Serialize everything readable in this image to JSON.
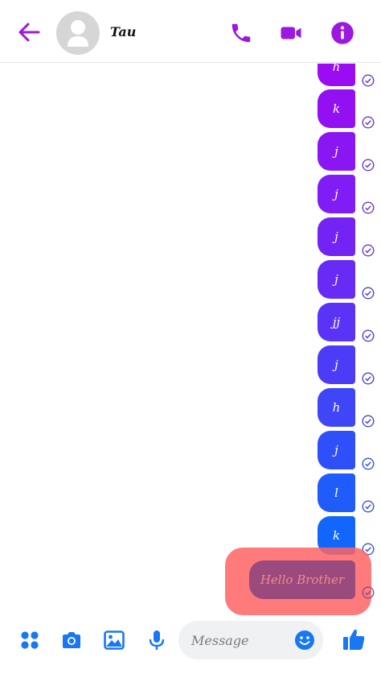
{
  "header": {
    "contact_name": "Tau",
    "icons": [
      "back-arrow-icon",
      "avatar-placeholder-icon",
      "phone-icon",
      "video-call-icon",
      "info-icon"
    ]
  },
  "colors": {
    "accent_purple": "#9b18e0",
    "accent_blue": "#1877f2"
  },
  "messages": [
    {
      "text": "h",
      "color": "#9a0df2"
    },
    {
      "text": "k",
      "color": "#9310f2"
    },
    {
      "text": "j",
      "color": "#8a16f3"
    },
    {
      "text": "j",
      "color": "#7f1df4"
    },
    {
      "text": "j",
      "color": "#7324f4"
    },
    {
      "text": "j",
      "color": "#672bf5"
    },
    {
      "text": "jj",
      "color": "#5a33f6"
    },
    {
      "text": "j",
      "color": "#4c3cf7"
    },
    {
      "text": "h",
      "color": "#3e46f8"
    },
    {
      "text": "j",
      "color": "#2f50f9"
    },
    {
      "text": "l",
      "color": "#205cfa"
    },
    {
      "text": "k",
      "color": "#1266fb"
    },
    {
      "text": "Hello Brother",
      "color": "#9a4a7c"
    }
  ],
  "composer": {
    "placeholder": "Message",
    "icons": [
      "apps-grid-icon",
      "camera-icon",
      "gallery-icon",
      "microphone-icon",
      "emoji-icon",
      "thumbs-up-icon"
    ]
  }
}
